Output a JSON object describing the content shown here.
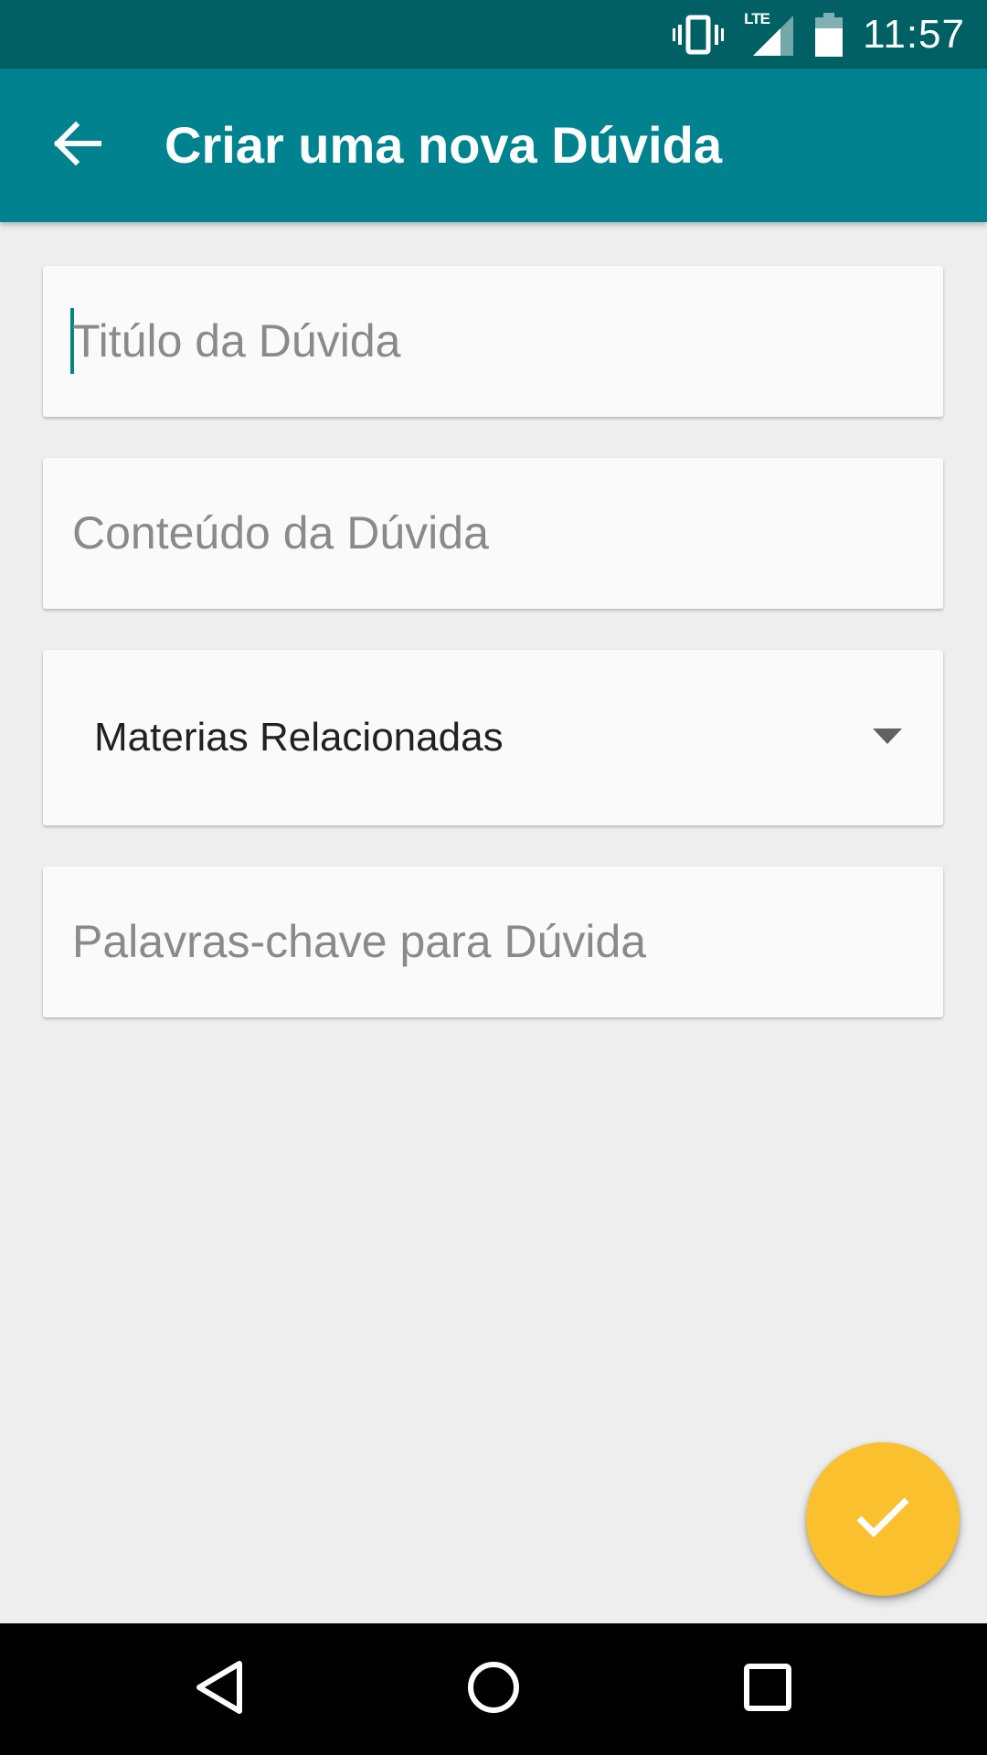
{
  "status_bar": {
    "time": "11:57",
    "network_label": "LTE",
    "icons": [
      "vibrate-icon",
      "signal-icon",
      "battery-icon"
    ]
  },
  "app_bar": {
    "title": "Criar uma nova Dúvida",
    "back_icon": "arrow-back-icon",
    "background": "#00838f",
    "status_background": "#006064"
  },
  "form": {
    "title_field": {
      "placeholder": "Titúlo da Dúvida",
      "value": ""
    },
    "content_field": {
      "placeholder": "Conteúdo da Dúvida",
      "value": ""
    },
    "subjects_select": {
      "selected": "Materias Relacionadas"
    },
    "keywords_field": {
      "placeholder": "Palavras-chave para Dúvida",
      "value": ""
    }
  },
  "fab": {
    "icon": "check-icon",
    "color": "#fbc02d"
  },
  "nav_bar": {
    "icons": [
      "back-triangle-icon",
      "home-circle-icon",
      "recents-square-icon"
    ]
  }
}
